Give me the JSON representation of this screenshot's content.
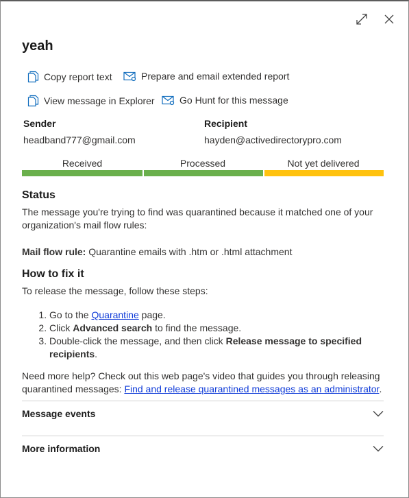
{
  "panel": {
    "title": "yeah"
  },
  "window_controls": {
    "expand_icon": "expand-icon",
    "close_icon": "close-icon"
  },
  "actions": {
    "copy_report": {
      "label": "Copy report text",
      "icon": "copy-icon"
    },
    "prepare_email": {
      "label": "Prepare and email extended report",
      "icon": "email-icon"
    },
    "view_explorer": {
      "label": "View message in Explorer",
      "icon": "copy-icon"
    },
    "go_hunt": {
      "label": "Go Hunt for this message",
      "icon": "email-icon"
    }
  },
  "sender": {
    "label": "Sender",
    "value": "headband777@gmail.com"
  },
  "recipient": {
    "label": "Recipient",
    "value": "hayden@activedirectorypro.com"
  },
  "stages": [
    {
      "label": "Received",
      "color": "#6ab04c"
    },
    {
      "label": "Processed",
      "color": "#6ab04c"
    },
    {
      "label": "Not yet delivered",
      "color": "#ffc20e"
    }
  ],
  "status": {
    "heading": "Status",
    "text": "The message you're trying to find was quarantined because it matched one of your organization's mail flow rules:",
    "rule_label": "Mail flow rule:",
    "rule_value": " Quarantine emails with .htm or .html attachment"
  },
  "fix": {
    "heading": "How to fix it",
    "intro": "To release the message, follow these steps:",
    "step1_pre": "Go to the ",
    "step1_link": "Quarantine",
    "step1_post": " page.",
    "step2_pre": "Click ",
    "step2_bold": "Advanced search",
    "step2_post": " to find the message.",
    "step3_pre": "Double-click the message, and then click ",
    "step3_bold": "Release message to specified recipients",
    "step3_post": ".",
    "help_text": "Need more help? Check out this web page's video that guides you through releasing quarantined messages: ",
    "help_link": "Find and release quarantined messages as an administrator",
    "help_post": "."
  },
  "sections": {
    "message_events": "Message events",
    "more_information": "More information"
  }
}
